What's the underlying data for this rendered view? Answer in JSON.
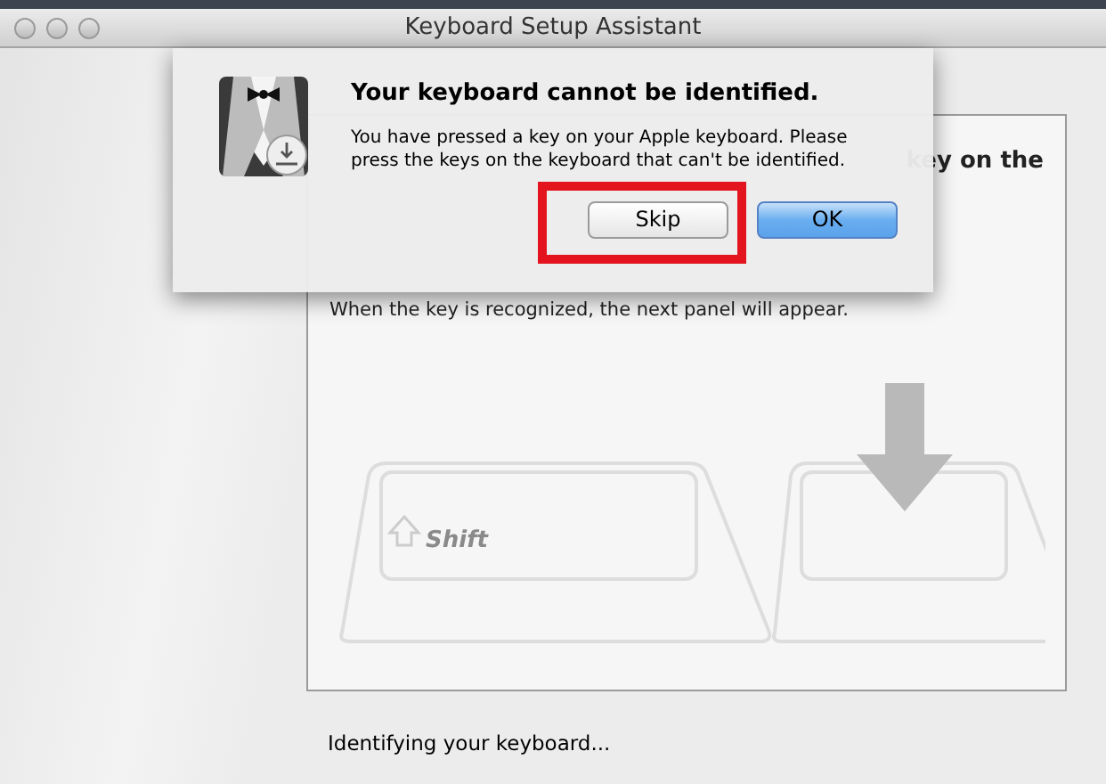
{
  "window": {
    "title": "Keyboard Setup Assistant"
  },
  "panel": {
    "heading_fragment": "key on the",
    "instruction": "When the key is recognized, the next panel will appear.",
    "key_label": "Shift"
  },
  "status": "Identifying your keyboard...",
  "alert": {
    "title": "Your keyboard cannot be identified.",
    "message": "You have pressed a key on your Apple keyboard. Please press the keys on the keyboard that can't be identified.",
    "buttons": [
      {
        "label": "Skip",
        "default": false,
        "highlighted": true
      },
      {
        "label": "OK",
        "default": true,
        "highlighted": false
      }
    ]
  }
}
